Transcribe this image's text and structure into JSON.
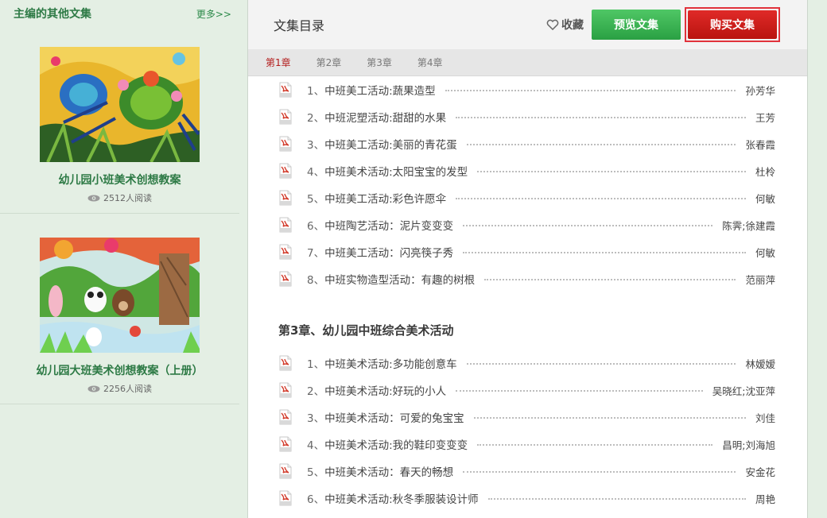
{
  "sidebar": {
    "title": "主编的其他文集",
    "more": "更多>>",
    "books": [
      {
        "title": "幼儿园小班美术创想教案",
        "reads": "2512人阅读",
        "icon": "eye-icon"
      },
      {
        "title": "幼儿园大班美术创想教案（上册）",
        "reads": "2256人阅读",
        "icon": "eye-icon"
      }
    ]
  },
  "header": {
    "title": "文集目录",
    "favorite": "收藏",
    "preview": "预览文集",
    "buy": "购买文集"
  },
  "tabs": [
    "第1章",
    "第2章",
    "第3章",
    "第4章"
  ],
  "active_tab": 0,
  "section1": {
    "items": [
      {
        "num": "1、",
        "title": "中班美工活动:蔬果造型",
        "author": "孙芳华"
      },
      {
        "num": "2、",
        "title": "中班泥塑活动:甜甜的水果",
        "author": "王芳"
      },
      {
        "num": "3、",
        "title": "中班美工活动:美丽的青花蛋",
        "author": "张春霞"
      },
      {
        "num": "4、",
        "title": "中班美术活动:太阳宝宝的发型",
        "author": "杜柃"
      },
      {
        "num": "5、",
        "title": "中班美工活动:彩色许愿伞",
        "author": "何敏"
      },
      {
        "num": "6、",
        "title": "中班陶艺活动：泥片变变变",
        "author": "陈霁;徐建霞"
      },
      {
        "num": "7、",
        "title": "中班美工活动：闪亮筷子秀",
        "author": "何敏"
      },
      {
        "num": "8、",
        "title": "中班实物造型活动：有趣的树根",
        "author": "范丽萍"
      }
    ]
  },
  "section3": {
    "heading": "第3章、幼儿园中班综合美术活动",
    "items": [
      {
        "num": "1、",
        "title": "中班美术活动:多功能创意车",
        "author": "林嫒嫒"
      },
      {
        "num": "2、",
        "title": "中班美术活动:好玩的小人",
        "author": "吴晓红;沈亚萍"
      },
      {
        "num": "3、",
        "title": "中班美术活动：可爱的兔宝宝",
        "author": "刘佳"
      },
      {
        "num": "4、",
        "title": "中班美术活动:我的鞋印变变变",
        "author": "昌明;刘海旭"
      },
      {
        "num": "5、",
        "title": "中班美术活动：春天的畅想",
        "author": "安金花"
      },
      {
        "num": "6、",
        "title": "中班美术活动:秋冬季服装设计师",
        "author": "周艳"
      }
    ]
  },
  "colors": {
    "sidebar_bg": "#e4efe4",
    "accent_green": "#2d7a45",
    "preview_btn": "#3cb552",
    "buy_btn": "#d01e1c",
    "active_tab": "#b31c1c"
  }
}
